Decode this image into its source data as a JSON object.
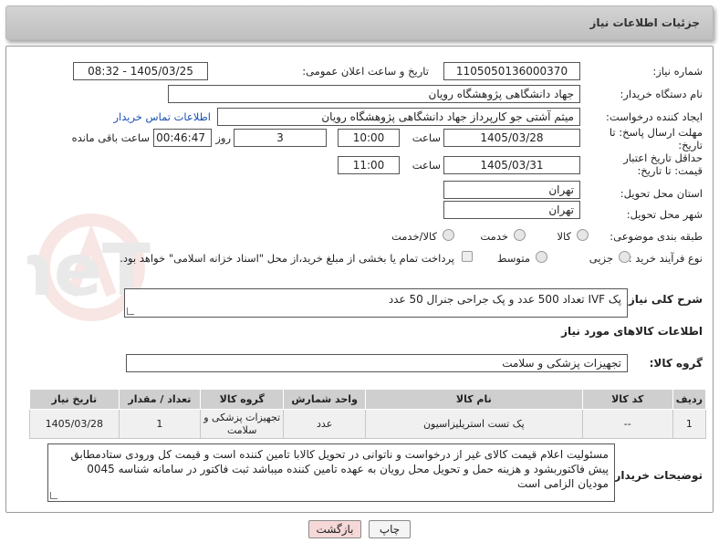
{
  "header": {
    "title": "جزئیات اطلاعات نیاز"
  },
  "form": {
    "need_number_label": "شماره نیاز:",
    "need_number": "1105050136000370",
    "announce_label": "تاریخ و ساعت اعلان عمومی:",
    "announce_value": "1405/03/25 - 08:32",
    "buyer_org_label": "نام دستگاه خریدار:",
    "buyer_org": "جهاد دانشگاهی پژوهشگاه رویان",
    "creator_label": "ایجاد کننده درخواست:",
    "creator": "میثم  آشتی جو کارپرداز جهاد دانشگاهی پژوهشگاه رویان",
    "contact_link": "اطلاعات تماس خریدار",
    "reply_deadline_label": "مهلت ارسال پاسخ: تا تاریخ:",
    "reply_date": "1405/03/28",
    "time_label": "ساعت",
    "reply_time": "10:00",
    "days_value": "3",
    "days_label": "روز و",
    "remaining_time": "00:46:47",
    "remaining_label": "ساعت باقی مانده",
    "price_validity_label": "حداقل تاریخ اعتبار قیمت: تا تاریخ:",
    "price_date": "1405/03/31",
    "price_time": "11:00",
    "province_label": "استان محل تحویل:",
    "province": "تهران",
    "city_label": "شهر محل تحویل:",
    "city": "تهران",
    "category_label": "طبقه بندی موضوعی:",
    "category_options": [
      "کالا",
      "خدمت",
      "کالا/خدمت"
    ],
    "process_label": "نوع فرآیند خرید :",
    "process_options": [
      "جزیی",
      "متوسط"
    ],
    "payment_note": "پرداخت تمام یا بخشی از مبلغ خرید،از محل \"اسناد خزانه اسلامی\" خواهد بود.",
    "summary_label": "شرح کلی نیاز:",
    "summary": "پک IVF تعداد 500 عدد و پک جراحی جنرال 50 عدد",
    "goods_info_label": "اطلاعات کالاهای مورد نیاز",
    "goods_group_label": "گروه کالا:",
    "goods_group": "تجهیزات پزشکی و سلامت"
  },
  "table": {
    "headers": [
      "ردیف",
      "کد کالا",
      "نام کالا",
      "واحد شمارش",
      "گروه کالا",
      "تعداد / مقدار",
      "تاریخ نیاز"
    ],
    "rows": [
      [
        "1",
        "--",
        "پک تست استریلیزاسیون",
        "عدد",
        "تجهیزات پزشکی و سلامت",
        "1",
        "1405/03/28"
      ]
    ]
  },
  "notes": {
    "label": "توضیحات خریدار:",
    "text": "مسئولیت اعلام قیمت کالای غیر از درخواست و ناتوانی در تحویل کالابا تامین کننده است و قیمت کل ورودی ستادمطابق پیش فاکتوربشود و هزینه حمل و تحویل محل رویان به عهده تامین کننده میباشد ثبت فاکتور در سامانه شناسه 0045 مودیان الزامی است"
  },
  "buttons": {
    "print": "چاپ",
    "back": "بازگشت"
  },
  "watermark": "AriaTender.neT",
  "colors": {
    "link": "#1a4fb5",
    "back_button": "#f6d8d8",
    "print_button": "#f4f4f4"
  }
}
